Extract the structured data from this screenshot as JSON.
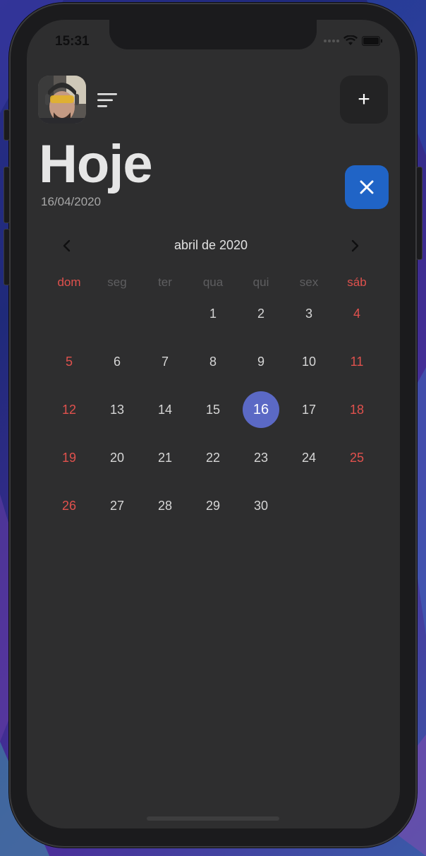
{
  "status_bar": {
    "time": "15:31"
  },
  "header": {
    "title": "Hoje",
    "date": "16/04/2020",
    "add_label": "+"
  },
  "calendar": {
    "month_label": "abril de 2020",
    "weekdays": [
      "dom",
      "seg",
      "ter",
      "qua",
      "qui",
      "sex",
      "sáb"
    ],
    "leading_blank_days": 3,
    "days": [
      "1",
      "2",
      "3",
      "4",
      "5",
      "6",
      "7",
      "8",
      "9",
      "10",
      "11",
      "12",
      "13",
      "14",
      "15",
      "16",
      "17",
      "18",
      "19",
      "20",
      "21",
      "22",
      "23",
      "24",
      "25",
      "26",
      "27",
      "28",
      "29",
      "30"
    ],
    "selected_day": "16"
  },
  "icons": {
    "avatar": "avatar-photo",
    "menu": "sort-lines-icon",
    "add": "plus-icon",
    "close": "close-icon",
    "prev": "chevron-left-icon",
    "next": "chevron-right-icon"
  },
  "colors": {
    "screen_bg": "#2e2e2f",
    "selected_day": "#5b69c5",
    "weekend": "#e0514d",
    "close_button": "#2064c6"
  }
}
